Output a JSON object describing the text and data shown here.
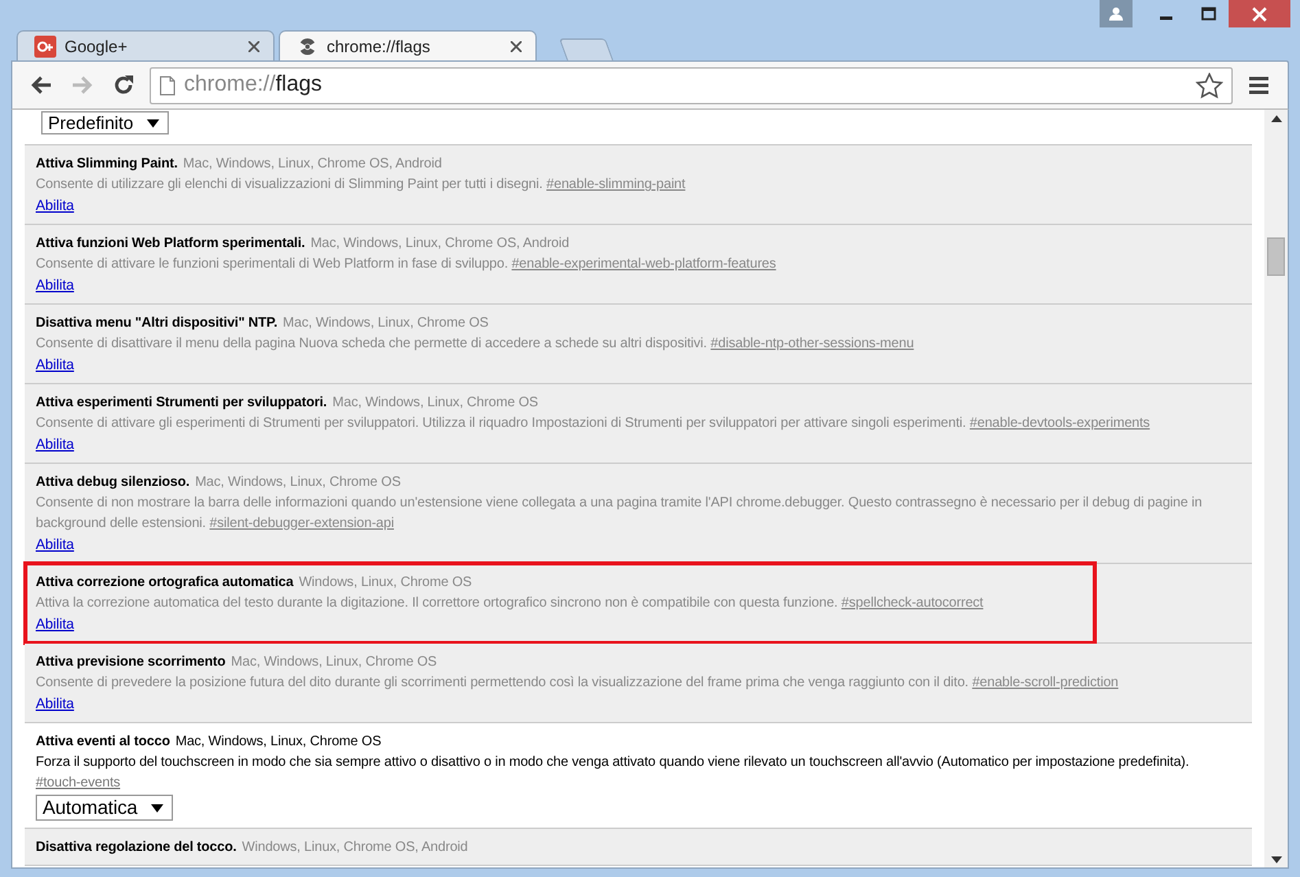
{
  "tabs": [
    {
      "label": "Google+",
      "selected": false
    },
    {
      "label": "chrome://flags",
      "selected": true
    }
  ],
  "address": {
    "scheme": "chrome://",
    "path": "flags"
  },
  "toolbar": {
    "forward_disabled": true
  },
  "top_control": {
    "kind": "select",
    "value": "Predefinito"
  },
  "experiments": [
    {
      "title": "Attiva Slimming Paint.",
      "platforms": "Mac, Windows, Linux, Chrome OS, Android",
      "description": "Consente di utilizzare gli elenchi di visualizzazioni di Slimming Paint per tutti i disegni.",
      "flag": "#enable-slimming-paint",
      "supported": false,
      "highlighted": false,
      "action": {
        "kind": "link",
        "label": "Abilita"
      }
    },
    {
      "title": "Attiva funzioni Web Platform sperimentali.",
      "platforms": "Mac, Windows, Linux, Chrome OS, Android",
      "description": "Consente di attivare le funzioni sperimentali di Web Platform in fase di sviluppo.",
      "flag": "#enable-experimental-web-platform-features",
      "supported": false,
      "highlighted": false,
      "action": {
        "kind": "link",
        "label": "Abilita"
      }
    },
    {
      "title": "Disattiva menu \"Altri dispositivi\" NTP.",
      "platforms": "Mac, Windows, Linux, Chrome OS",
      "description": "Consente di disattivare il menu della pagina Nuova scheda che permette di accedere a schede su altri dispositivi.",
      "flag": "#disable-ntp-other-sessions-menu",
      "supported": false,
      "highlighted": false,
      "action": {
        "kind": "link",
        "label": "Abilita"
      }
    },
    {
      "title": "Attiva esperimenti Strumenti per sviluppatori.",
      "platforms": "Mac, Windows, Linux, Chrome OS",
      "description": "Consente di attivare gli esperimenti di Strumenti per sviluppatori. Utilizza il riquadro Impostazioni di Strumenti per sviluppatori per attivare singoli esperimenti.",
      "flag": "#enable-devtools-experiments",
      "supported": false,
      "highlighted": false,
      "action": {
        "kind": "link",
        "label": "Abilita"
      }
    },
    {
      "title": "Attiva debug silenzioso.",
      "platforms": "Mac, Windows, Linux, Chrome OS",
      "description": "Consente di non mostrare la barra delle informazioni quando un'estensione viene collegata a una pagina tramite l'API chrome.debugger. Questo contrassegno è necessario per il debug di pagine in background delle estensioni.",
      "flag": "#silent-debugger-extension-api",
      "supported": false,
      "highlighted": false,
      "action": {
        "kind": "link",
        "label": "Abilita"
      }
    },
    {
      "title": "Attiva correzione ortografica automatica",
      "platforms": "Windows, Linux, Chrome OS",
      "description": "Attiva la correzione automatica del testo durante la digitazione. Il correttore ortografico sincrono non è compatibile con questa funzione.",
      "flag": "#spellcheck-autocorrect",
      "supported": false,
      "highlighted": true,
      "action": {
        "kind": "link",
        "label": "Abilita"
      }
    },
    {
      "title": "Attiva previsione scorrimento",
      "platforms": "Mac, Windows, Linux, Chrome OS",
      "description": "Consente di prevedere la posizione futura del dito durante gli scorrimenti permettendo così la visualizzazione del frame prima che venga raggiunto con il dito.",
      "flag": "#enable-scroll-prediction",
      "supported": false,
      "highlighted": false,
      "action": {
        "kind": "link",
        "label": "Abilita"
      }
    },
    {
      "title": "Attiva eventi al tocco",
      "platforms": "Mac, Windows, Linux, Chrome OS",
      "description": "Forza il supporto del touchscreen in modo che sia sempre attivo o disattivo o in modo che venga attivato quando viene rilevato un touchscreen all'avvio (Automatico per impostazione predefinita).",
      "flag": "#touch-events",
      "supported": true,
      "highlighted": false,
      "action": {
        "kind": "select",
        "value": "Automatica"
      }
    },
    {
      "title": "Disattiva regolazione del tocco.",
      "platforms": "Windows, Linux, Chrome OS, Android",
      "supported": false,
      "highlighted": false
    }
  ]
}
